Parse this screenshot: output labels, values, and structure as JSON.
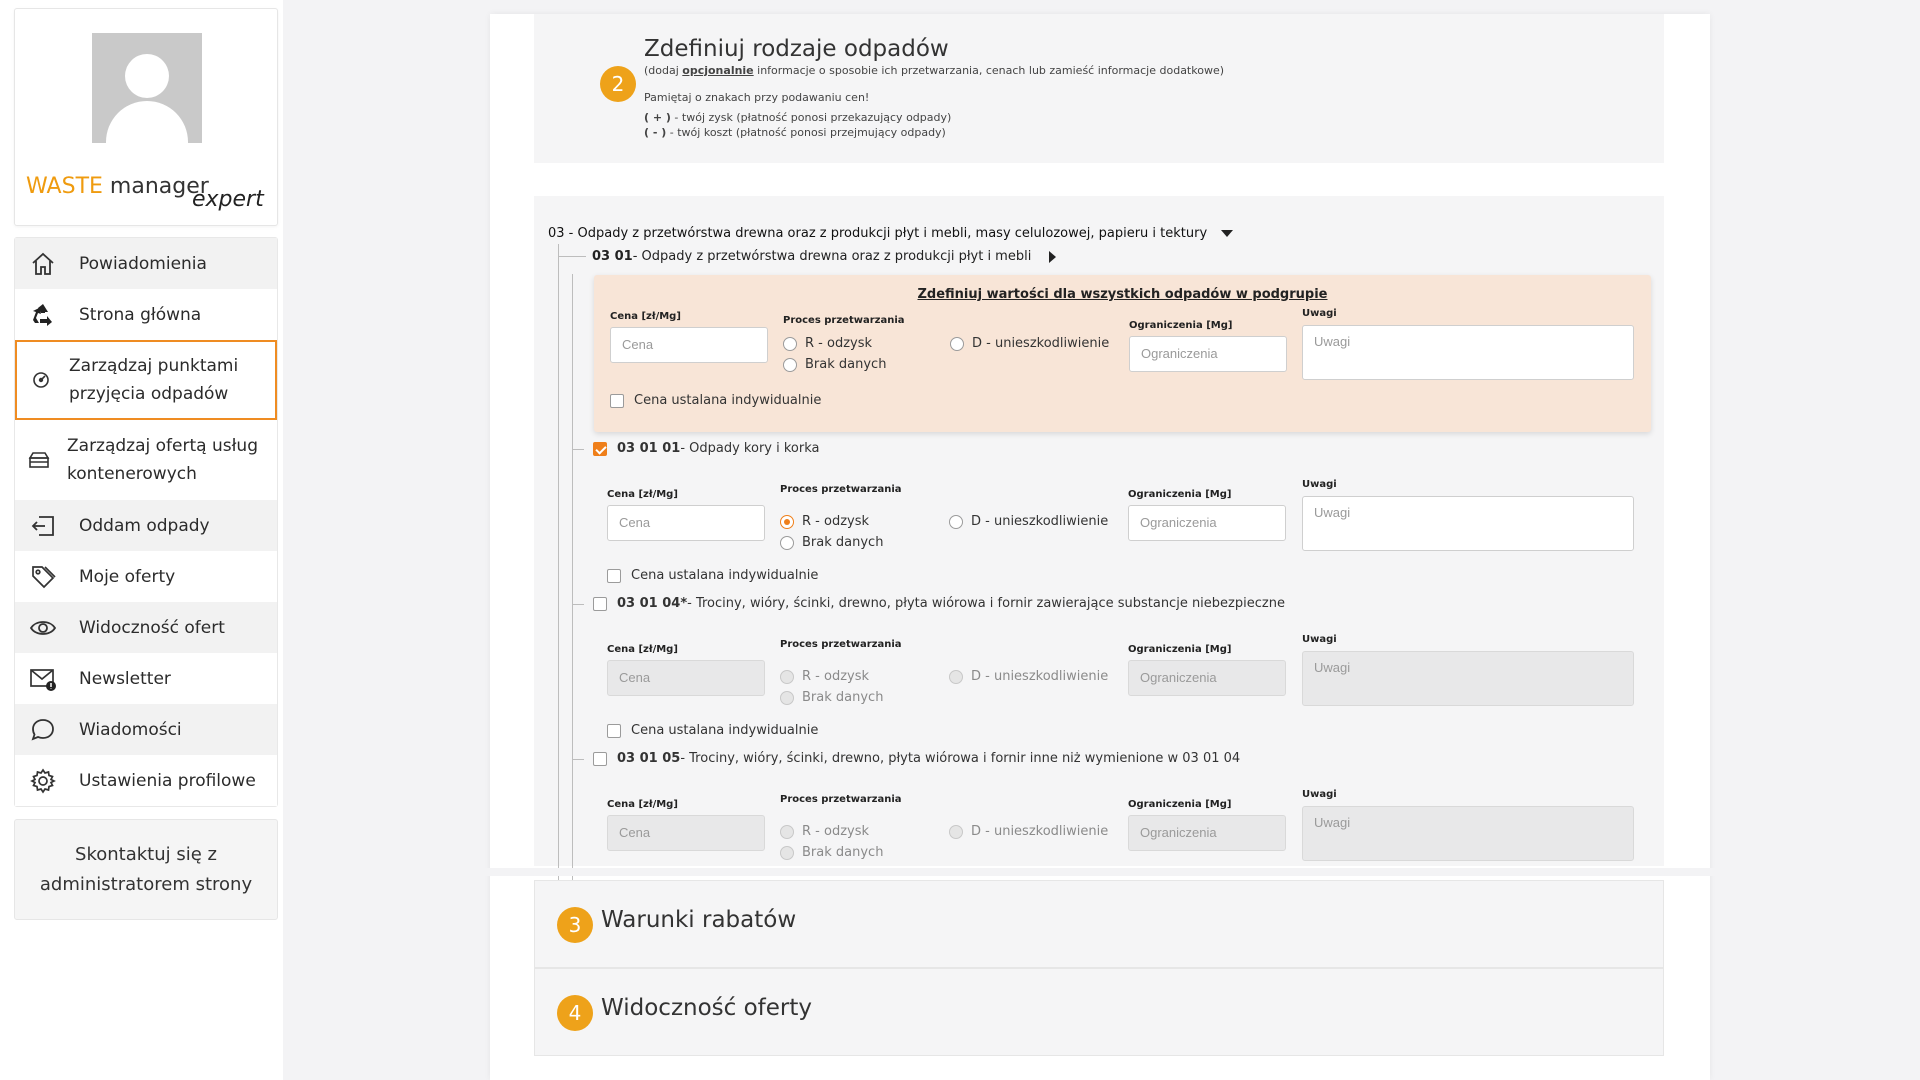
{
  "brand": {
    "waste": "WASTE",
    "manager": "manager",
    "expert": "expert"
  },
  "menu": [
    {
      "label": "Powiadomienia",
      "icon": "home-icon"
    },
    {
      "label": "Strona główna",
      "icon": "recycle-icon"
    },
    {
      "label": "Zarządzaj punktami przyjęcia odpadów",
      "icon": "manage-points-icon"
    },
    {
      "label": "Zarządzaj ofertą usług kontenerowych",
      "icon": "container-icon"
    },
    {
      "label": "Oddam odpady",
      "icon": "give-away-icon"
    },
    {
      "label": "Moje oferty",
      "icon": "tags-icon"
    },
    {
      "label": "Widoczność ofert",
      "icon": "eye-icon"
    },
    {
      "label": "Newsletter",
      "icon": "newsletter-icon"
    },
    {
      "label": "Wiadomości",
      "icon": "chat-icon"
    },
    {
      "label": "Ustawienia profilowe",
      "icon": "gear-icon"
    }
  ],
  "contact": {
    "line1": "Skontaktuj się z",
    "line2": "administratorem strony"
  },
  "section2": {
    "number": "2",
    "title": "Zdefiniuj rodzaje odpadów",
    "sub_pre": "(dodaj ",
    "sub_link": "opcjonalnie",
    "sub_post": " informacje o sposobie ich przetwarzania, cenach lub zamieść informacje dodatkowe)",
    "note1": "Pamiętaj o znakach przy podawaniu cen!",
    "note2_sign": "( + )",
    "note2": " - twój zysk (płatność ponosi przekazujący odpady)",
    "note3_sign": "( - )",
    "note3": " - twój koszt (płatność ponosi przejmujący odpady)"
  },
  "tree": {
    "group": "03 - Odpady z przetwórstwa drewna oraz z produkcji płyt i mebli, masy celulozowej, papieru i tektury",
    "sub_code": "03 01",
    "sub_name": "- Odpady z przetwórstwa drewna oraz z produkcji płyt i mebli"
  },
  "labels": {
    "price": "Cena [zł/Mg]",
    "process": "Proces przetwarzania",
    "limits": "Ograniczenia [Mg]",
    "notes": "Uwagi",
    "price_ph": "Cena",
    "limits_ph": "Ograniczenia",
    "notes_ph": "Uwagi",
    "r": "R - odzysk",
    "d": "D - unieszkodliwienie",
    "none": "Brak danych",
    "individual": "Cena ustalana indywidualnie"
  },
  "defaults": {
    "title": "Zdefiniuj wartości dla wszystkich odpadów w podgrupie"
  },
  "items": [
    {
      "code": "03 01 01",
      "name": " - Odpady kory i korka",
      "checked": true
    },
    {
      "code": "03 01 04*",
      "name": " - Trociny, wióry, ścinki, drewno, płyta wiórowa i fornir zawierające substancje niebezpieczne",
      "checked": false
    },
    {
      "code": "03 01 05",
      "name": " - Trociny, wióry, ścinki, drewno, płyta wiórowa i fornir inne niż wymienione w 03 01 04",
      "checked": false
    }
  ],
  "section3": {
    "number": "3",
    "title": "Warunki rabatów"
  },
  "section4": {
    "number": "4",
    "title": "Widoczność oferty"
  },
  "colors": {
    "accent": "#ef9b0f",
    "active_border": "#ef8c22",
    "step": "#eea21a",
    "defaults_bg": "#f8e5d7"
  }
}
